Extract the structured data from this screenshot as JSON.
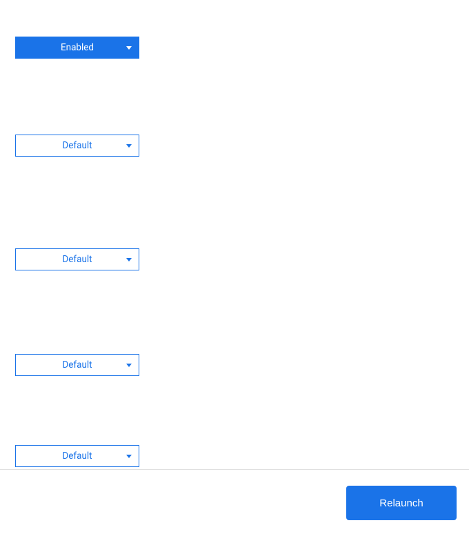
{
  "dropdowns": [
    {
      "label": "Enabled",
      "style": "enabled"
    },
    {
      "label": "Default",
      "style": "default"
    },
    {
      "label": "Default",
      "style": "default"
    },
    {
      "label": "Default",
      "style": "default"
    },
    {
      "label": "Default",
      "style": "default"
    }
  ],
  "footer": {
    "relaunch_label": "Relaunch"
  }
}
